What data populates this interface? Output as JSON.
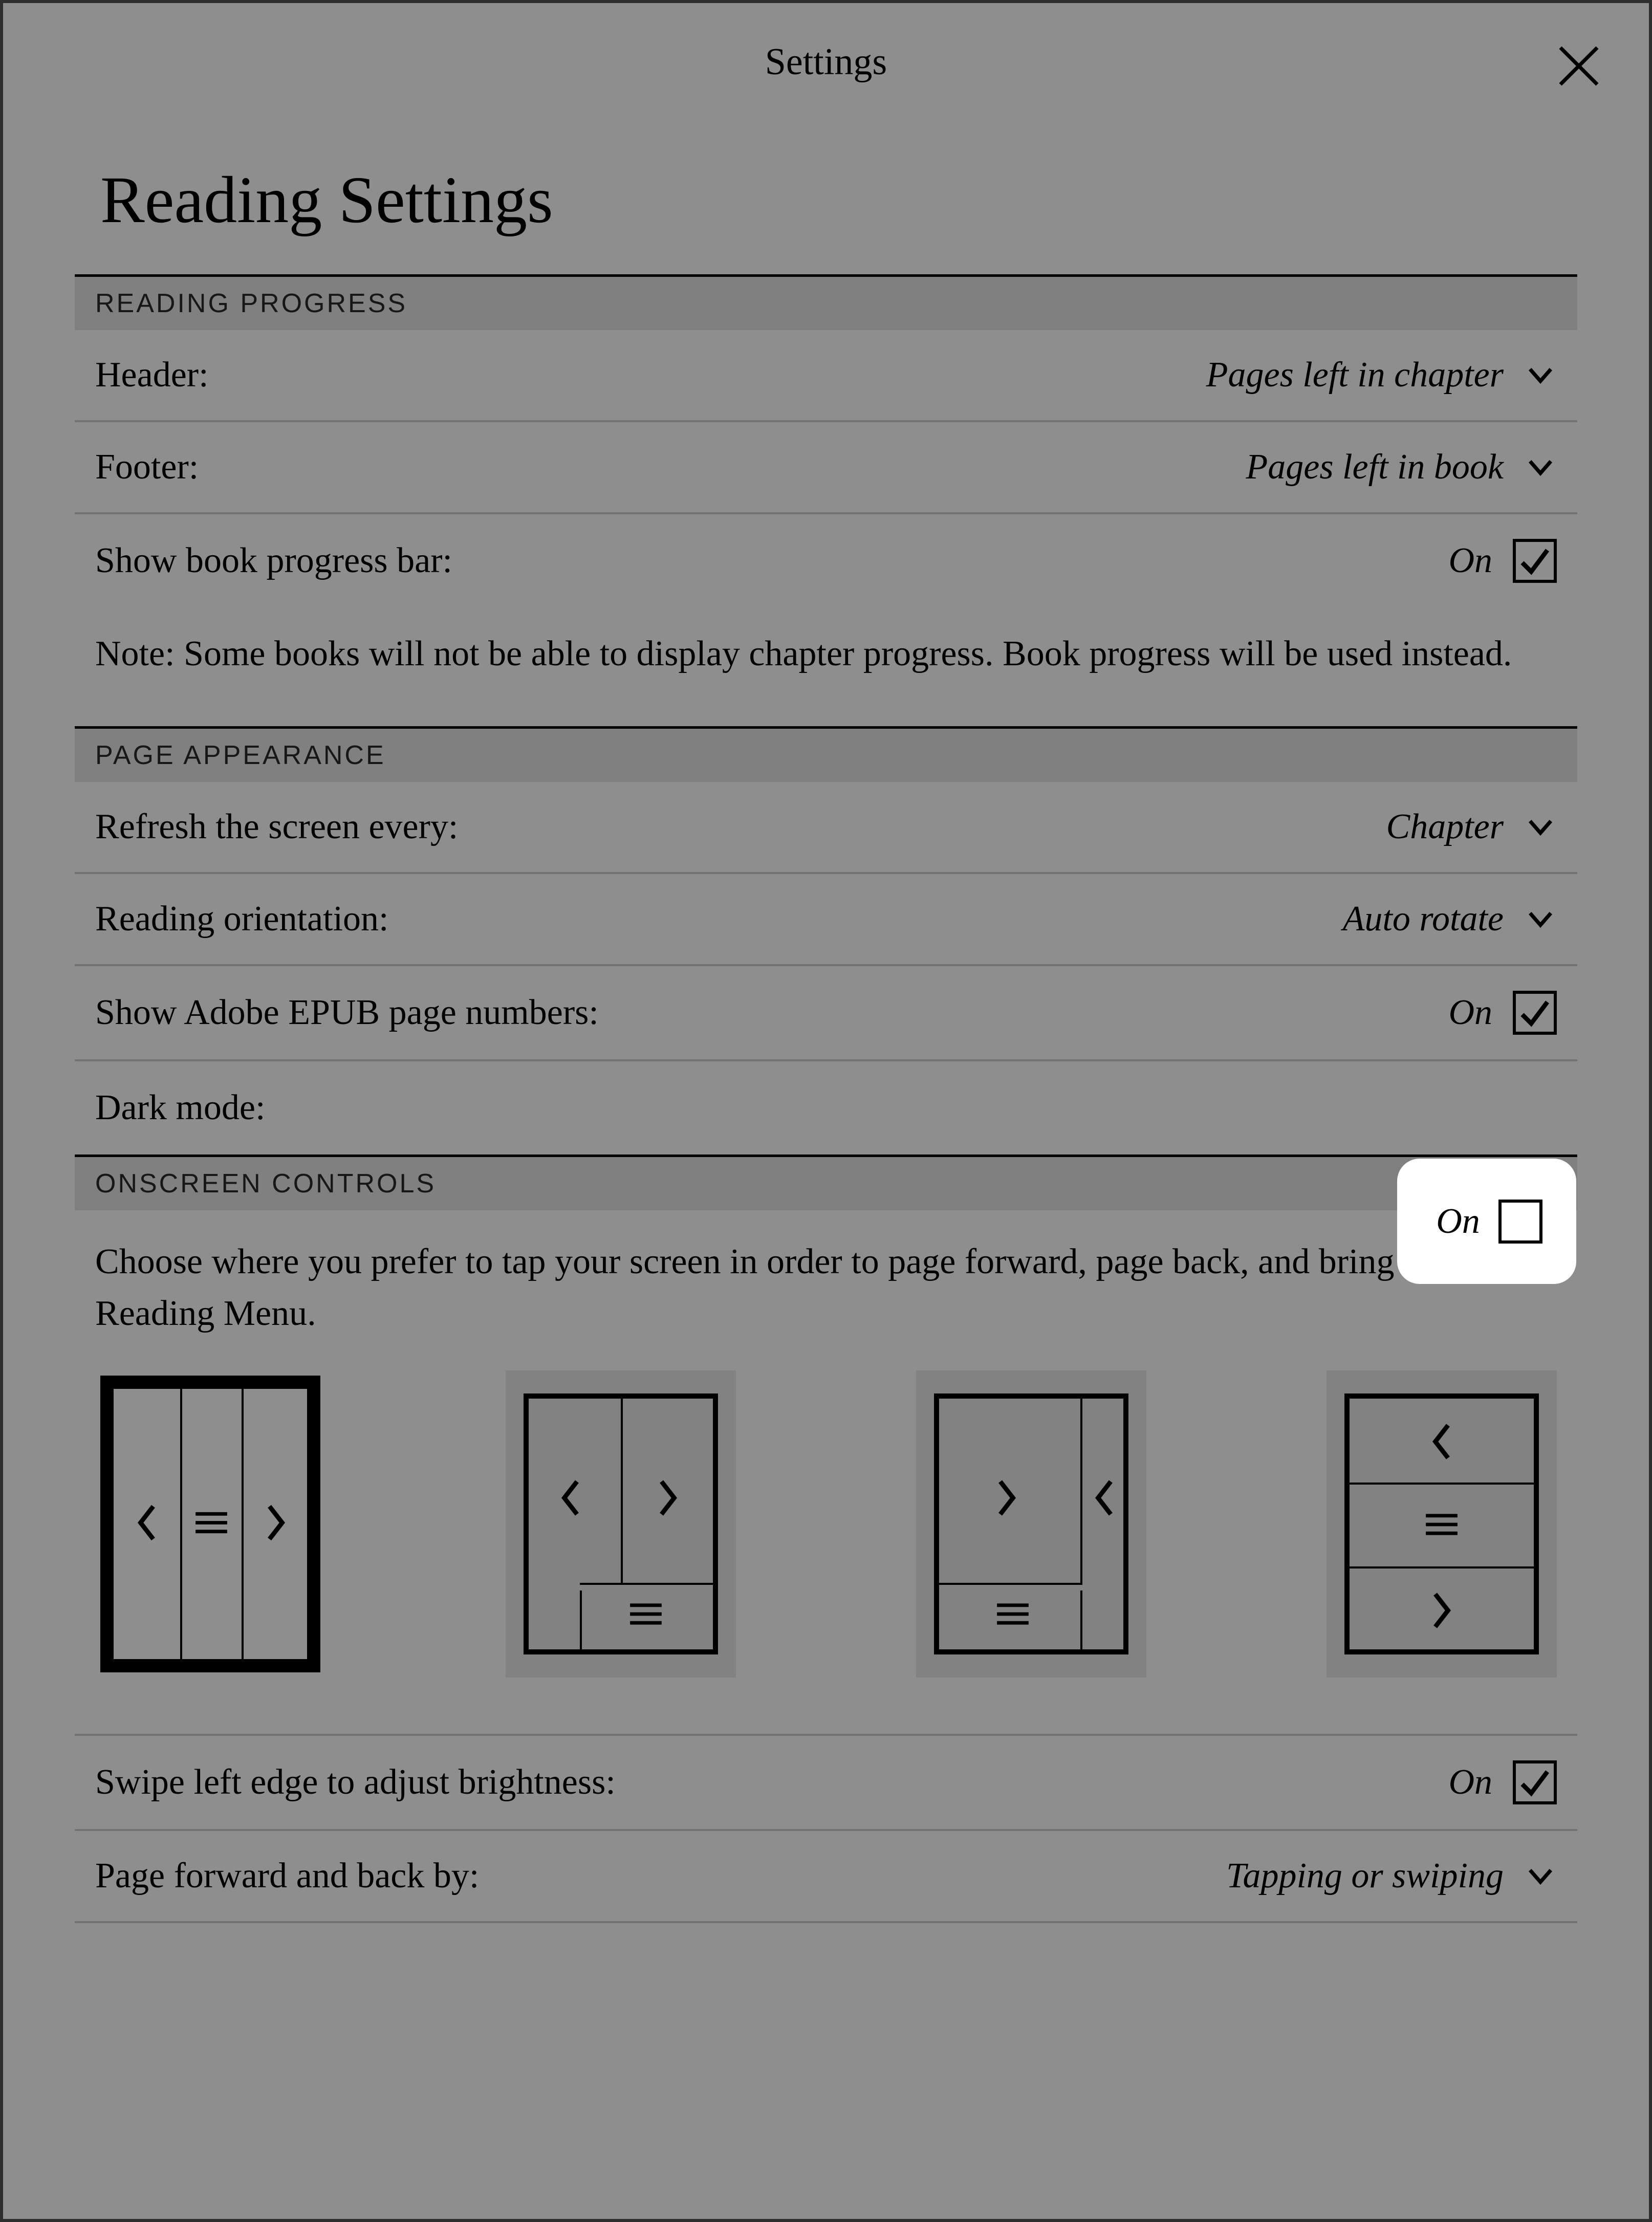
{
  "header": {
    "title": "Settings"
  },
  "page": {
    "title": "Reading Settings"
  },
  "sections": {
    "progress": {
      "heading": "READING PROGRESS",
      "header_row": {
        "label": "Header:",
        "value": "Pages left in chapter"
      },
      "footer_row": {
        "label": "Footer:",
        "value": "Pages left in book"
      },
      "progress_bar_row": {
        "label": "Show book progress bar:",
        "value": "On",
        "checked": true
      },
      "note": "Note: Some books will not be able to display chapter progress. Book progress will be used instead."
    },
    "appearance": {
      "heading": "PAGE APPEARANCE",
      "refresh_row": {
        "label": "Refresh the screen every:",
        "value": "Chapter"
      },
      "orientation_row": {
        "label": "Reading orientation:",
        "value": "Auto rotate"
      },
      "adobe_row": {
        "label": "Show Adobe EPUB page numbers:",
        "value": "On",
        "checked": true
      },
      "dark_row": {
        "label": "Dark mode:",
        "value": "On",
        "checked": false
      }
    },
    "controls": {
      "heading": "ONSCREEN CONTROLS",
      "desc": "Choose where you prefer to tap your screen in order to page forward, page back, and bring up the Reading Menu.",
      "selected_layout": 0,
      "swipe_row": {
        "label": "Swipe left edge to adjust brightness:",
        "value": "On",
        "checked": true
      },
      "paging_row": {
        "label": "Page forward and back by:",
        "value": "Tapping or swiping"
      }
    }
  }
}
